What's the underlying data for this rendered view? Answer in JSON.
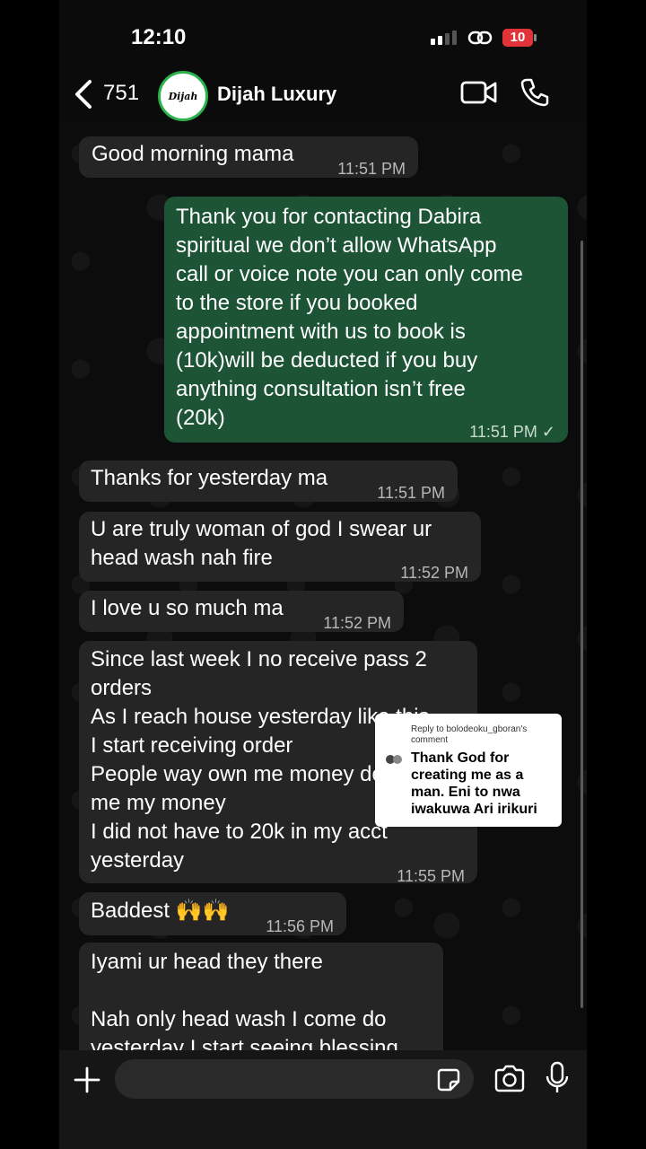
{
  "status_bar": {
    "time": "12:10",
    "battery": "10"
  },
  "header": {
    "back_count": "751",
    "avatar_text": "Dijah",
    "contact_name": "Dijah Luxury"
  },
  "messages": [
    {
      "dir": "in",
      "text": "Good morning mama",
      "time": "11:51 PM"
    },
    {
      "dir": "out",
      "text": "Thank you for contacting Dabira\nspiritual we don’t allow WhatsApp\ncall or voice note you can only come\nto the store if you booked\nappointment with us to book is\n(10k)will be deducted if you buy\nanything consultation isn’t free\n(20k)",
      "time": "11:51 PM ✓"
    },
    {
      "dir": "in",
      "text": "Thanks for yesterday ma",
      "time": "11:51 PM"
    },
    {
      "dir": "in",
      "text": "U are truly woman of god I swear ur\nhead wash nah fire",
      "time": "11:52 PM"
    },
    {
      "dir": "in",
      "text": "I love u so much ma",
      "time": "11:52 PM"
    },
    {
      "dir": "in",
      "text": "Since last week I no receive pass 2\norders\nAs I reach house yesterday like this\nI start receiving order\nPeople way own me money dey give\nme my money\nI did not have to 20k in my acct\nyesterday",
      "time": "11:55 PM"
    },
    {
      "dir": "in",
      "text": "Baddest 🙌🙌",
      "time": "11:56 PM"
    },
    {
      "dir": "in",
      "text": "Iyami ur head they there\n\nNah only head wash I come do\nyesterday I start seeing blessing",
      "time": ""
    }
  ],
  "reply_overlay": {
    "heading": "Reply to bolodeoku_gboran's comment",
    "comment": "Thank God for creating me as a man. Eni to nwa iwakuwa Ari irikuri"
  },
  "composer": {
    "placeholder": ""
  },
  "colors": {
    "incoming": "#252525",
    "outgoing": "#1c5435",
    "accent": "#2bb24c"
  }
}
